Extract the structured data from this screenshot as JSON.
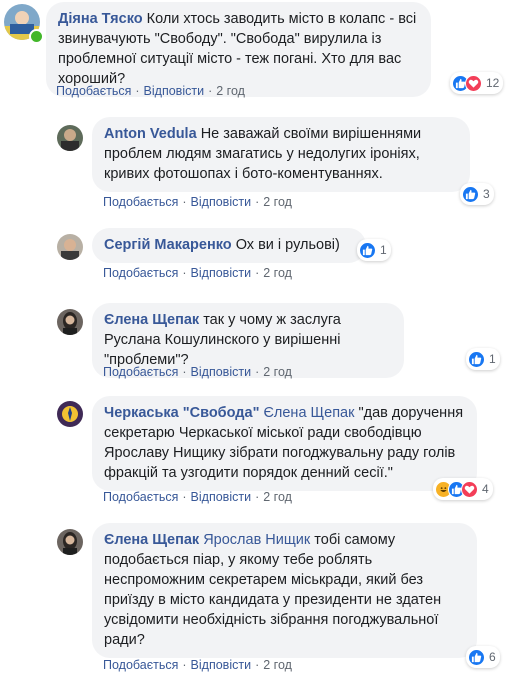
{
  "comments": [
    {
      "author": "Діяна Тяско",
      "mention": "",
      "text": "Коли хтось заводить місто в колапс - всі звинувачують \"Свободу\". \"Свобода\" вирулила із проблемної ситуації місто - теж погані. Хто для вас хороший?",
      "like_label": "Подобається",
      "reply_label": "Відповісти",
      "time": "2 год",
      "reaction_count": "12",
      "reactions": [
        "like-icon",
        "love-icon"
      ]
    },
    {
      "author": "Anton Vedula",
      "mention": "",
      "text": "Не заважай своїми вирішеннями проблем людям змагатись у недолугих іроніях, кривих фотошопах і бото-коментуваннях.",
      "like_label": "Подобається",
      "reply_label": "Відповісти",
      "time": "2 год",
      "reaction_count": "3",
      "reactions": [
        "like-icon"
      ]
    },
    {
      "author": "Сергій Макаренко",
      "mention": "",
      "text": "Ох ви і рульові)",
      "like_label": "Подобається",
      "reply_label": "Відповісти",
      "time": "2 год",
      "reaction_count": "1",
      "reactions": [
        "like-icon"
      ]
    },
    {
      "author": "Єлена Щепак",
      "mention": "",
      "text": "так у чому ж заслуга Руслана Кошулинского у вирішенні \"проблеми\"?",
      "like_label": "Подобається",
      "reply_label": "Відповісти",
      "time": "2 год",
      "reaction_count": "1",
      "reactions": [
        "like-icon"
      ]
    },
    {
      "author": "Черкаська \"Свобода\"",
      "mention": "Єлена Щепак",
      "text": "\"дав доручення секретарю Черкаської міської ради свободівцю Ярославу Нищику зібрати погоджувальну раду голів фракцій та узгодити порядок денний сесії.\"",
      "like_label": "Подобається",
      "reply_label": "Відповісти",
      "time": "2 год",
      "reaction_count": "4",
      "reactions": [
        "haha-icon",
        "like-icon",
        "love-icon"
      ]
    },
    {
      "author": "Єлена Щепак",
      "mention": "Ярослав Нищик",
      "text": "тобі самому подобається піар, у якому тебе роблять неспроможним секретарем міськради, який без приїзду в місто кандидата у президенти не здатен усвідомити необхідність зібрання погоджувальної ради?",
      "like_label": "Подобається",
      "reply_label": "Відповісти",
      "time": "2 год",
      "reaction_count": "6",
      "reactions": [
        "like-icon"
      ]
    }
  ]
}
